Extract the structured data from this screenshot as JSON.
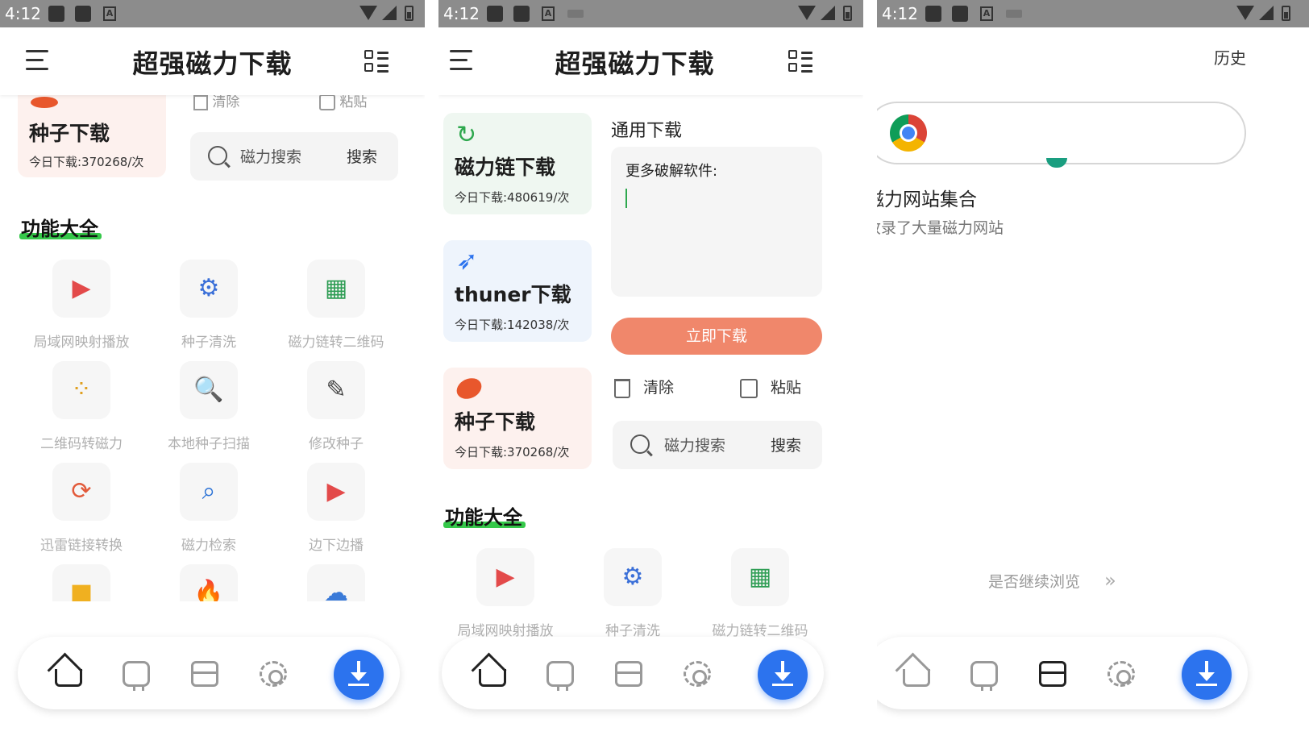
{
  "status": {
    "time": "4:12"
  },
  "app": {
    "title": "超强磁力下载"
  },
  "cards": {
    "magnet": {
      "title": "磁力链下载",
      "count": "今日下载:480619/次"
    },
    "thunder": {
      "title": "thuner下载",
      "count": "今日下载:142038/次"
    },
    "torrent": {
      "title": "种子下载",
      "count": "今日下载:370268/次"
    }
  },
  "general": {
    "title": "通用下载",
    "textarea_text": "更多破解软件:",
    "download_button": "立即下载",
    "clear_label": "清除",
    "paste_label": "粘贴",
    "search_placeholder": "磁力搜索",
    "search_button": "搜索"
  },
  "features": {
    "title": "功能大全",
    "items": [
      {
        "label": "局域网映射播放",
        "icon": "video-cast-icon"
      },
      {
        "label": "种子清洗",
        "icon": "gear-progress-icon"
      },
      {
        "label": "磁力链转二维码",
        "icon": "qr-code-icon"
      },
      {
        "label": "二维码转磁力",
        "icon": "qr-dots-icon"
      },
      {
        "label": "本地种子扫描",
        "icon": "magnifier-scan-icon"
      },
      {
        "label": "修改种子",
        "icon": "pen-edit-icon"
      },
      {
        "label": "迅雷链接转换",
        "icon": "link-convert-icon"
      },
      {
        "label": "磁力检索",
        "icon": "magnet-search-icon"
      },
      {
        "label": "边下边播",
        "icon": "play-video-icon"
      },
      {
        "label": "",
        "icon": "folder-icon"
      },
      {
        "label": "",
        "icon": "fire-icon"
      },
      {
        "label": "",
        "icon": "cloud-download-icon"
      }
    ]
  },
  "browser": {
    "history_label": "历史",
    "site_title": "磁力网站集合",
    "site_subtitle": "收录了大量磁力网站",
    "continue_label": "是否继续浏览"
  },
  "colors": {
    "accent_blue": "#2c73ee",
    "download_button": "#f0876b",
    "section_highlight": "#35c84a",
    "magnet_card": "#eff7f1",
    "thunder_card": "#eef4fc",
    "torrent_card": "#fdf1ee"
  }
}
